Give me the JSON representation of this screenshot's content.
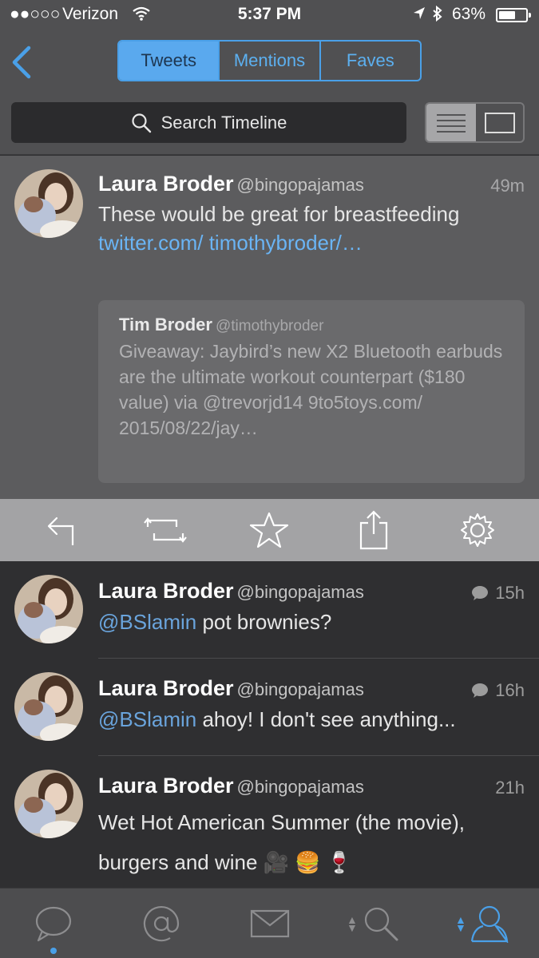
{
  "status_bar": {
    "signal": "●●○○○",
    "carrier": "Verizon",
    "time": "5:37 PM",
    "battery_pct": "63%",
    "battery_level": 0.63
  },
  "header": {
    "tabs": [
      {
        "label": "Tweets",
        "active": true
      },
      {
        "label": "Mentions",
        "active": false
      },
      {
        "label": "Faves",
        "active": false
      }
    ],
    "search_placeholder": "Search Timeline"
  },
  "expanded_tweet": {
    "name": "Laura Broder",
    "handle": "@bingopajamas",
    "time": "49m",
    "text": "These would be great for breastfeeding ",
    "link": "twitter.com/ timothybroder/…",
    "quote": {
      "name": "Tim Broder",
      "handle": "@timothybroder",
      "text": "Giveaway: Jaybird’s new X2 Bluetooth earbuds are the ultimate workout counterpart ($180 value) via @trevorjd14 9to5toys.com/ 2015/08/22/jay…"
    }
  },
  "tweets": [
    {
      "name": "Laura Broder",
      "handle": "@bingopajamas",
      "time": "15h",
      "has_reply": true,
      "mention": "@BSlamin",
      "text": " pot brownies?"
    },
    {
      "name": "Laura Broder",
      "handle": "@bingopajamas",
      "time": "16h",
      "has_reply": true,
      "mention": "@BSlamin",
      "text": " ahoy! I don't see anything..."
    },
    {
      "name": "Laura Broder",
      "handle": "@bingopajamas",
      "time": "21h",
      "has_reply": false,
      "mention": "",
      "text": "Wet Hot American Summer (the movie), burgers and wine 🎥 🍔 🍷"
    }
  ],
  "icons": {
    "back": "chevron-left-icon",
    "search": "magnifier-icon",
    "actions": [
      "reply-icon",
      "retweet-icon",
      "star-icon",
      "share-icon",
      "gear-icon"
    ],
    "tabs": [
      "timeline-bubble-icon",
      "mentions-at-icon",
      "messages-envelope-icon",
      "search-icon",
      "profile-icon"
    ]
  },
  "colors": {
    "accent": "#4aa0e8",
    "mention": "#6aa4dc",
    "link": "#6ab4f4"
  }
}
